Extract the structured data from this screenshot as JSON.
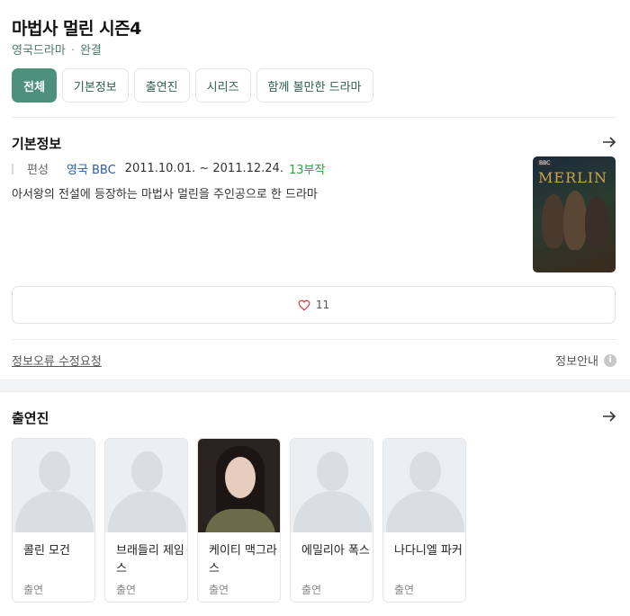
{
  "title": "마법사 멀린 시즌4",
  "subtitle": {
    "category": "영국드라마",
    "status": "완결"
  },
  "tabs": [
    {
      "label": "전체",
      "active": true
    },
    {
      "label": "기본정보",
      "active": false
    },
    {
      "label": "출연진",
      "active": false
    },
    {
      "label": "시리즈",
      "active": false
    },
    {
      "label": "함께 볼만한 드라마",
      "active": false
    }
  ],
  "basic_info": {
    "section_title": "기본정보",
    "label": "편성",
    "channel": "영국 BBC",
    "dates": "2011.10.01. ~ 2011.12.24.",
    "episodes": "13부작",
    "description": "아서왕의 전설에 등장하는 마법사 멀린을 주인공으로 한 드라마",
    "poster_title": "MERLIN",
    "poster_badge": "BBC"
  },
  "like": {
    "count": "11"
  },
  "footer": {
    "report": "정보오류 수정요청",
    "guide": "정보안내",
    "guide_icon": "i"
  },
  "cast": {
    "section_title": "출연진",
    "members": [
      {
        "name": "콜린 모건",
        "role": "출연",
        "photo": "placeholder"
      },
      {
        "name": "브래들리 제임스",
        "role": "출연",
        "photo": "placeholder"
      },
      {
        "name": "케이티 맥그라스",
        "role": "출연",
        "photo": "portrait"
      },
      {
        "name": "에밀리아 폭스",
        "role": "출연",
        "photo": "placeholder"
      },
      {
        "name": "나다니엘 파커",
        "role": "출연",
        "photo": "placeholder"
      }
    ]
  },
  "colors": {
    "accent": "#4d907c",
    "episodes": "#2aa53a",
    "channel": "#2e5aa6",
    "heart": "#e0363b"
  }
}
